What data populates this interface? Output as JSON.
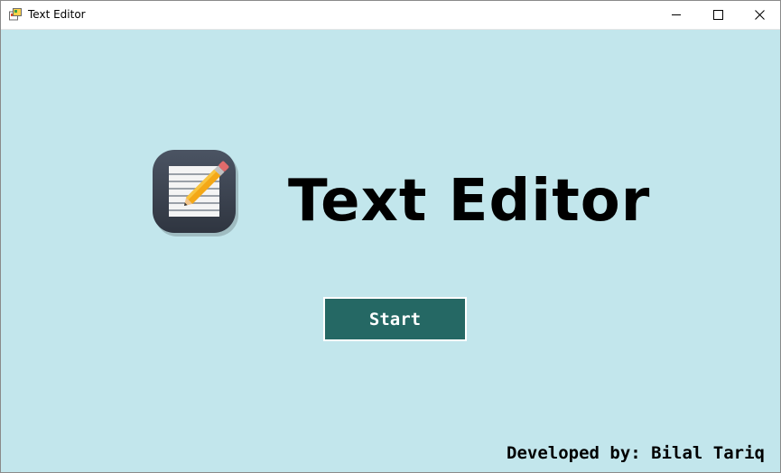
{
  "window": {
    "title": "Text Editor",
    "controls": {
      "minimize_icon": "minimize-icon",
      "maximize_icon": "maximize-icon",
      "close_icon": "close-icon"
    }
  },
  "main": {
    "logo_icon": "notepad-pencil-icon",
    "app_title": "Text Editor",
    "start_label": "Start",
    "credit": "Developed by: Bilal Tariq"
  },
  "colors": {
    "background": "#c2e6ec",
    "button": "#256864",
    "button_text": "#ffffff"
  }
}
